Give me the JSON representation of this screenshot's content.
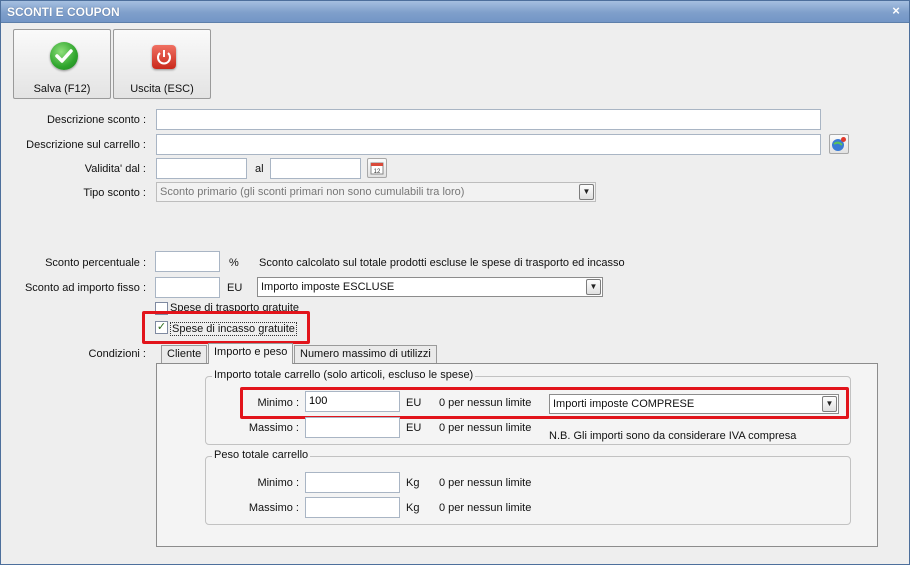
{
  "window": {
    "title": "SCONTI E COUPON",
    "close": "×"
  },
  "toolbar": {
    "save_label": "Salva (F12)",
    "exit_label": "Uscita (ESC)"
  },
  "form": {
    "descrizione_label": "Descrizione sconto :",
    "descrizione_value": "",
    "carrello_label": "Descrizione sul carrello :",
    "carrello_value": "",
    "validita_label": "Validita' dal :",
    "validita_dal": "",
    "al_label": "al",
    "validita_al": "",
    "tipo_label": "Tipo sconto :",
    "tipo_value": "Sconto primario (gli sconti primari non sono cumulabili tra loro)",
    "percentuale_label": "Sconto percentuale :",
    "percentuale_value": "",
    "percent_unit": "%",
    "percentuale_note": "Sconto calcolato sul totale prodotti escluse le spese di trasporto ed incasso",
    "importo_fisso_label": "Sconto ad importo fisso :",
    "importo_fisso_value": "",
    "importo_unit": "EU",
    "importo_fisso_combo": "Importo imposte ESCLUSE",
    "trasporto_label": "Spese di trasporto gratuite",
    "trasporto_checked": false,
    "incasso_label": "Spese di incasso gratuite",
    "incasso_checked": true,
    "condizioni_label": "Condizioni :"
  },
  "tabs": [
    {
      "label": "Cliente",
      "active": false
    },
    {
      "label": "Importo e peso",
      "active": true
    },
    {
      "label": "Numero massimo di utilizzi",
      "active": false
    }
  ],
  "importo_group": {
    "title": "Importo totale carrello (solo articoli, escluso le spese)",
    "minimo_label": "Minimo :",
    "minimo_value": "100",
    "minimo_unit": "EU",
    "minimo_note": "0 per nessun limite",
    "combo_value": "Importi imposte COMPRESE",
    "massimo_label": "Massimo :",
    "massimo_value": "",
    "massimo_unit": "EU",
    "massimo_note": "0 per nessun limite",
    "iva_note": "N.B. Gli importi sono da considerare IVA compresa"
  },
  "peso_group": {
    "title": "Peso totale carrello",
    "minimo_label": "Minimo :",
    "minimo_value": "",
    "minimo_unit": "Kg",
    "minimo_note": "0 per nessun limite",
    "massimo_label": "Massimo :",
    "massimo_value": "",
    "massimo_unit": "Kg",
    "massimo_note": "0 per nessun limite"
  },
  "colors": {
    "highlight": "#e2141b",
    "titlebar": "#7f9fcb"
  }
}
